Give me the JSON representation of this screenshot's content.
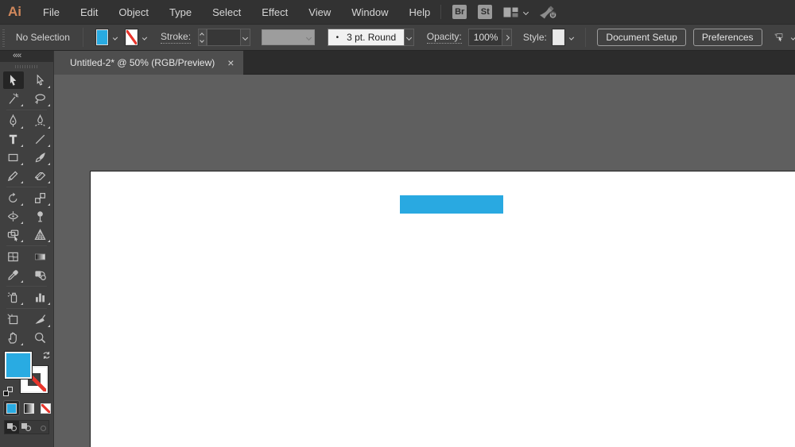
{
  "menubar": {
    "logo_text": "Ai",
    "items": [
      "File",
      "Edit",
      "Object",
      "Type",
      "Select",
      "Effect",
      "View",
      "Window",
      "Help"
    ],
    "bridge_label": "Br",
    "stock_label": "St"
  },
  "controlbar": {
    "selection_status": "No Selection",
    "stroke_label": "Stroke:",
    "stroke_weight_value": "",
    "profile_bullet": "•",
    "profile_value": "3 pt. Round",
    "opacity_label": "Opacity:",
    "opacity_value": "100%",
    "style_label": "Style:",
    "document_setup_label": "Document Setup",
    "preferences_label": "Preferences"
  },
  "tabbar": {
    "document_title": "Untitled-2* @ 50% (RGB/Preview)",
    "close_glyph": "×"
  },
  "toolbar": {
    "collapse_glyph": "««",
    "selected_tool": "selection",
    "groups": [
      [
        [
          "selection",
          "direct-selection"
        ],
        [
          "magic-wand",
          "lasso"
        ]
      ],
      [
        [
          "pen",
          "curvature"
        ],
        [
          "type",
          "line-segment"
        ],
        [
          "rectangle",
          "paintbrush"
        ],
        [
          "shaper",
          "eraser"
        ]
      ],
      [
        [
          "rotate",
          "scale"
        ],
        [
          "width",
          "puppet-warp"
        ],
        [
          "shape-builder",
          "perspective-grid"
        ]
      ],
      [
        [
          "mesh",
          "gradient"
        ],
        [
          "eyedropper",
          "blend"
        ]
      ],
      [
        [
          "symbol-sprayer",
          "column-graph"
        ]
      ],
      [
        [
          "artboard",
          "slice"
        ],
        [
          "hand",
          "zoom"
        ]
      ]
    ]
  },
  "colors": {
    "fill_blue": "#29ABE2",
    "shape_blue": "#29A9E1",
    "none_slash_red": "#E8352C",
    "artboard_white": "#FFFFFF",
    "pasteboard_gray": "#5F5F5F"
  }
}
